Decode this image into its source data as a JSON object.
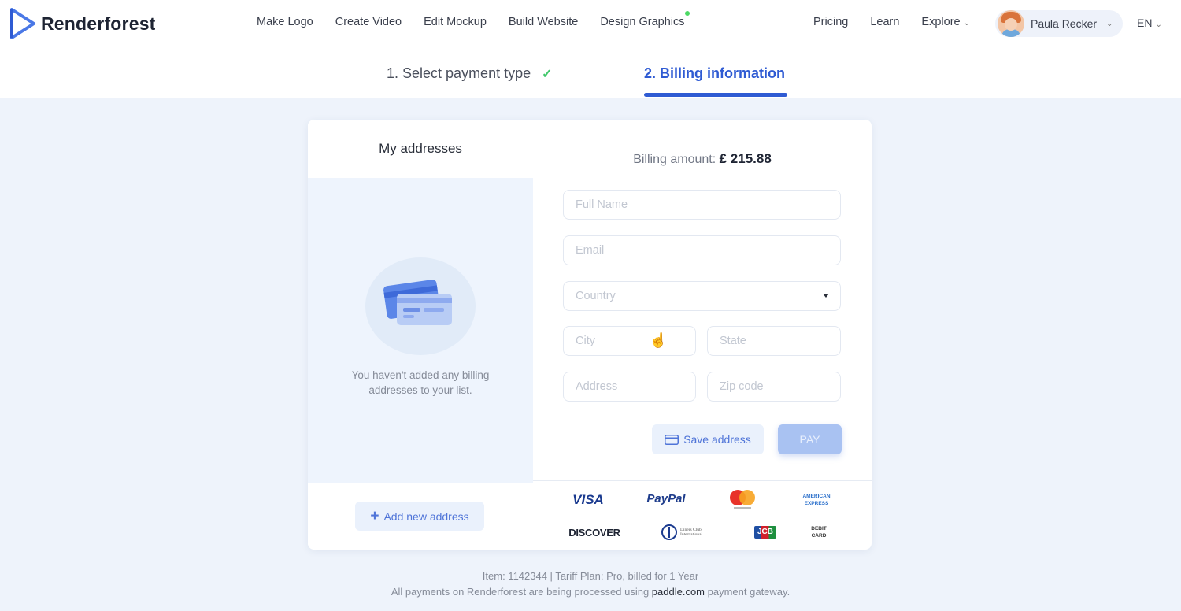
{
  "brand": {
    "name": "Renderforest",
    "accent": "#2f5bd3"
  },
  "nav": {
    "main": [
      "Make Logo",
      "Create Video",
      "Edit Mockup",
      "Build Website",
      "Design Graphics"
    ],
    "pricing": "Pricing",
    "learn": "Learn",
    "explore": "Explore",
    "user_name": "Paula Recker",
    "language": "EN"
  },
  "steps": {
    "step1": "1. Select payment type",
    "step2": "2. Billing information"
  },
  "addresses": {
    "title": "My addresses",
    "empty_line1": "You haven't added any billing",
    "empty_line2": "addresses to your list.",
    "add_button": "Add new address"
  },
  "billing": {
    "label": "Billing amount:",
    "amount": "£ 215.88"
  },
  "form": {
    "full_name": "Full Name",
    "email": "Email",
    "country": "Country",
    "city": "City",
    "state": "State",
    "address": "Address",
    "zip": "Zip code",
    "save_button": "Save address",
    "pay_button": "PAY"
  },
  "payment_logos": {
    "visa": "VISA",
    "paypal": "PayPal",
    "amex_line1": "AMERICAN",
    "amex_line2": "EXPRESS",
    "discover": "DISCOVER",
    "diners": "Diners Club International",
    "jcb": "JCB",
    "debit_line1": "DEBIT",
    "debit_line2": "CARD"
  },
  "footer": {
    "line1": "Item: 1142344 | Tariff Plan: Pro, billed for 1 Year",
    "line2_before": "All payments on Renderforest are being processed using",
    "gateway": "paddle.com",
    "line2_after": "payment gateway."
  }
}
